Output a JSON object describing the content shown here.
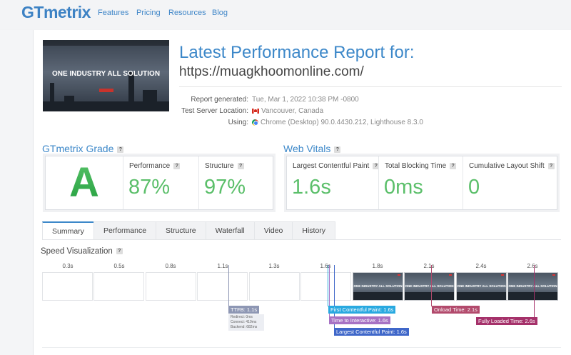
{
  "nav": {
    "logo_main": "GTmetrix",
    "items": [
      "Features",
      "Pricing",
      "Resources",
      "Blog"
    ]
  },
  "report": {
    "thumbnail_text": "ONE INDUSTRY ALL SOLUTION",
    "title": "Latest Performance Report for:",
    "url": "https://muagkhoomonline.com/",
    "generated_label": "Report generated:",
    "generated_value": "Tue, Mar 1, 2022 10:38 PM -0800",
    "server_label": "Test Server Location:",
    "server_value": "Vancouver, Canada",
    "using_label": "Using:",
    "using_value": "Chrome (Desktop) 90.0.4430.212, Lighthouse 8.3.0"
  },
  "grade": {
    "title": "GTmetrix Grade",
    "letter": "A",
    "performance_label": "Performance",
    "performance_value": "87%",
    "structure_label": "Structure",
    "structure_value": "97%"
  },
  "vitals": {
    "title": "Web Vitals",
    "lcp_label": "Largest Contentful Paint",
    "lcp_value": "1.6s",
    "tbt_label": "Total Blocking Time",
    "tbt_value": "0ms",
    "cls_label": "Cumulative Layout Shift",
    "cls_value": "0"
  },
  "tabs": [
    "Summary",
    "Performance",
    "Structure",
    "Waterfall",
    "Video",
    "History"
  ],
  "speed": {
    "title": "Speed Visualization",
    "ticks": [
      "0.3s",
      "0.5s",
      "0.8s",
      "1.1s",
      "1.3s",
      "1.6s",
      "1.8s",
      "2.1s",
      "2.4s",
      "2.6s"
    ],
    "frame_text": "ONE INDUSTRY ALL SOLUTION",
    "markers": {
      "ttfb": "TTFB: 1.1s",
      "redirect": "Redirect: 0ms",
      "connect": "Connect: 419ms",
      "backend": "Backend: 682ms",
      "fcp": "First Contentful Paint: 1.6s",
      "tti": "Time to Interactive: 1.6s",
      "lcp": "Largest Contentful Paint: 1.6s",
      "onload": "Onload Time: 2.1s",
      "fully": "Fully Loaded Time: 2.6s"
    },
    "colors": {
      "ttfb": "#8e97b4",
      "fcp": "#29a9e0",
      "tti": "#a772c4",
      "lcp": "#3f67c9",
      "onload": "#b24a6c",
      "fully": "#a5316a"
    }
  }
}
